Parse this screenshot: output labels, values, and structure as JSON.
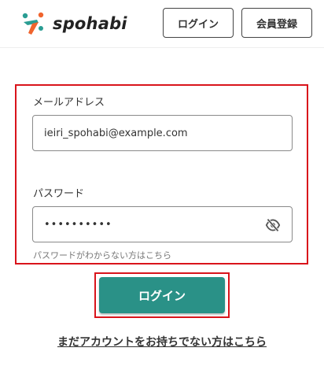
{
  "header": {
    "brand": "spohabi",
    "login_label": "ログイン",
    "register_label": "会員登録"
  },
  "form": {
    "email_label": "メールアドレス",
    "email_value": "ieiri_spohabi@example.com",
    "password_label": "パスワード",
    "password_value": "••••••••••",
    "forgot_link": "パスワードがわからない方はこちら",
    "submit_label": "ログイン"
  },
  "footer": {
    "no_account_link": "まだアカウントをお持ちでない方はこちら"
  },
  "colors": {
    "accent": "#2a9187",
    "highlight": "#d9141b",
    "logo_orange": "#f0642d",
    "logo_teal": "#2a9d93"
  },
  "icons": {
    "logo": "spohabi-logo-icon",
    "password_toggle": "eye-slash-icon"
  }
}
